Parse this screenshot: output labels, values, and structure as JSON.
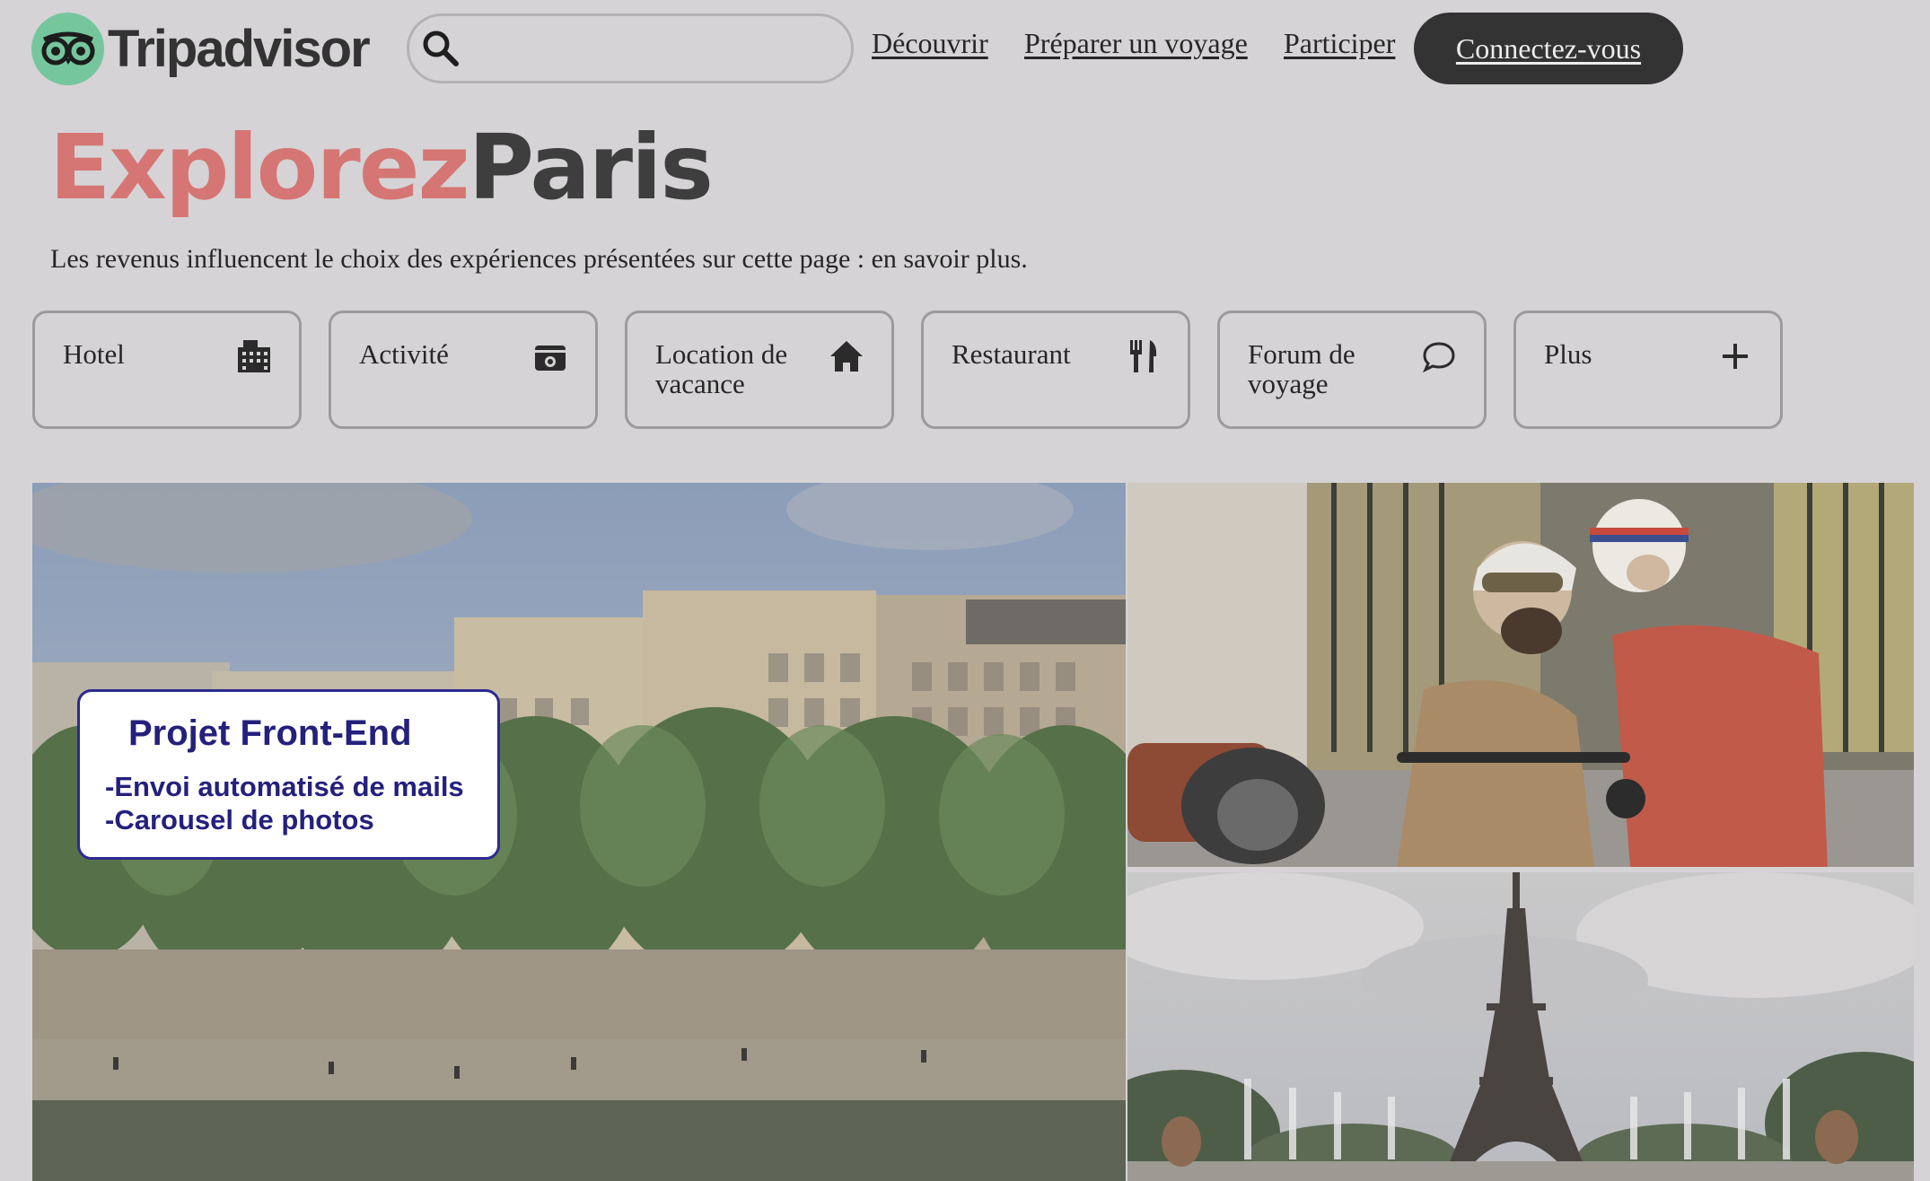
{
  "header": {
    "logo_text": "Tripadvisor",
    "search_placeholder": "",
    "nav": [
      "Découvrir",
      "Préparer un voyage",
      "Participer"
    ],
    "login_label": "Connectez-vous"
  },
  "hero": {
    "title_part1": "Explorez",
    "title_part2": "Paris",
    "subtitle": "Les revenus influencent le choix des expériences présentées sur cette page : en savoir plus."
  },
  "categories": [
    {
      "label": "Hotel",
      "icon": "hotel-icon"
    },
    {
      "label": "Activité",
      "icon": "ticket-icon"
    },
    {
      "label": "Location de vacance",
      "icon": "home-icon"
    },
    {
      "label": "Restaurant",
      "icon": "utensils-icon"
    },
    {
      "label": "Forum de voyage",
      "icon": "chat-bubble-icon"
    },
    {
      "label": "Plus",
      "icon": "plus-icon"
    }
  ],
  "overlay": {
    "title": "Projet Front-End",
    "line1": "-Envoi automatisé de mails",
    "line2": "-Carousel de photos"
  },
  "colors": {
    "background": "#d5d3d5",
    "title_accent": "#d57674",
    "title_dark": "#3e3e3e",
    "logo_green": "#75c69d",
    "button_dark": "#333333",
    "overlay_text": "#24207c"
  }
}
